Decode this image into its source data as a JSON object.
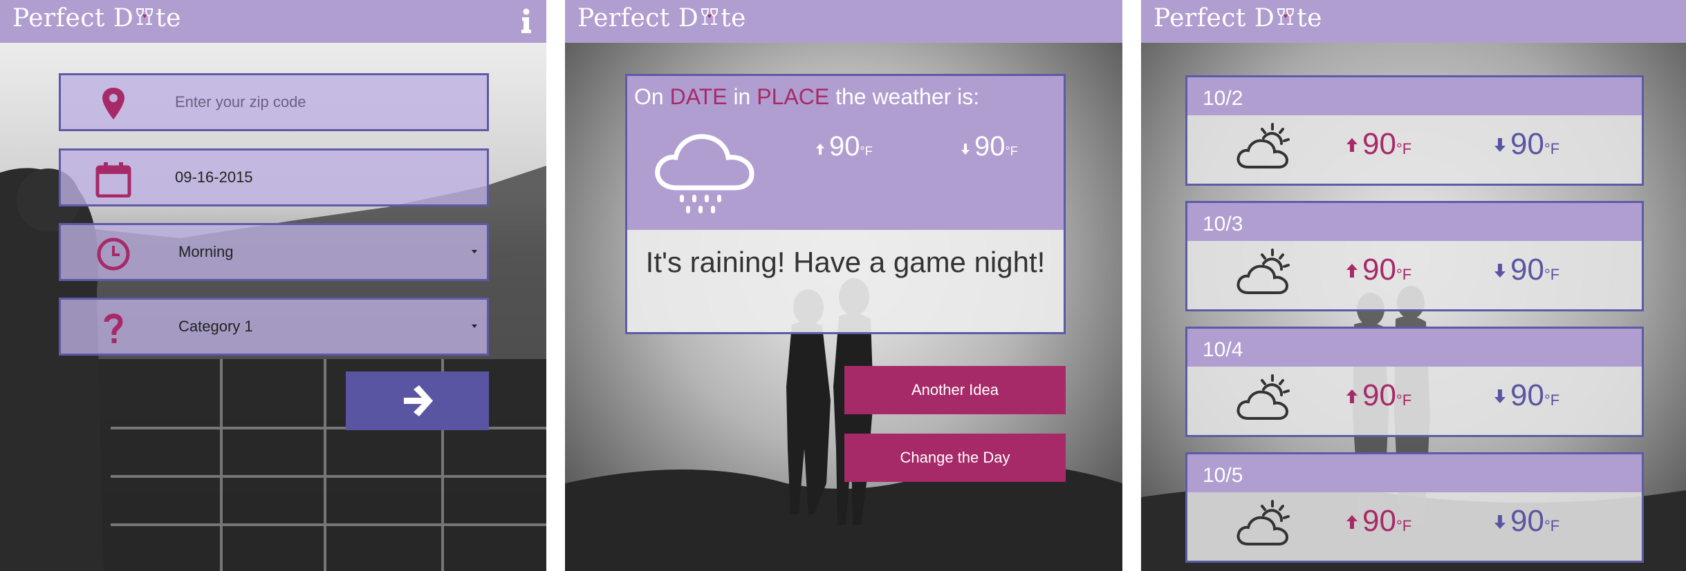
{
  "brand": {
    "name_before": "Perfect D",
    "name_after": "te"
  },
  "colors": {
    "lavender": "#b09ed0",
    "indigo": "#5d5aa6",
    "magenta": "#a72a68",
    "button_indigo": "#5a55a2"
  },
  "screen1": {
    "info_icon": "info-icon",
    "zip": {
      "icon": "location-pin-icon",
      "placeholder": "Enter your zip code"
    },
    "date": {
      "icon": "calendar-icon",
      "value": "09-16-2015"
    },
    "time": {
      "icon": "clock-icon",
      "value": "Morning"
    },
    "category": {
      "icon": "question-mark-icon",
      "value": "Category 1"
    },
    "submit_icon": "arrow-right-icon"
  },
  "screen2": {
    "title_on": "On",
    "title_date": "DATE",
    "title_in": "in",
    "title_place": "PLACE",
    "title_rest": "the weather is:",
    "weather_icon": "rain-cloud-icon",
    "high": "90",
    "low": "90",
    "unit": "°F",
    "message": "It's raining! Have a game night!",
    "another_idea": "Another Idea",
    "change_day": "Change the Day"
  },
  "screen3": {
    "unit": "°F",
    "days": [
      {
        "date": "10/2",
        "icon": "partly-cloudy-icon",
        "high": "90",
        "low": "90"
      },
      {
        "date": "10/3",
        "icon": "partly-cloudy-icon",
        "high": "90",
        "low": "90"
      },
      {
        "date": "10/4",
        "icon": "partly-cloudy-icon",
        "high": "90",
        "low": "90"
      },
      {
        "date": "10/5",
        "icon": "partly-cloudy-icon",
        "high": "90",
        "low": "90"
      }
    ]
  }
}
